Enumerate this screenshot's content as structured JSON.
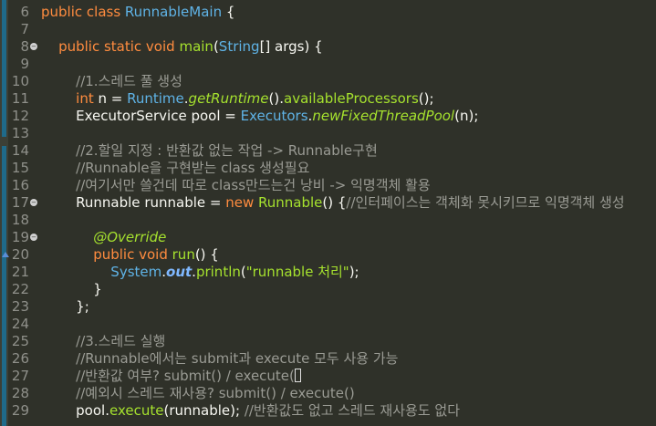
{
  "editor": {
    "language": "java",
    "colors": {
      "background": "#2f3129",
      "keyword": "#ff8c3f",
      "type": "#5fb3e6",
      "method": "#a6e22e",
      "comment": "#9a9b94",
      "line_number": "#8f908a",
      "gutter_strip": "#1f6a8a"
    },
    "lines": [
      {
        "n": "6",
        "fold": false,
        "segments": [
          [
            "kw",
            "public class "
          ],
          [
            "ty",
            "RunnableMain"
          ],
          [
            "op",
            " {"
          ]
        ]
      },
      {
        "n": "7",
        "fold": false,
        "segments": []
      },
      {
        "n": "8",
        "fold": true,
        "segments": [
          [
            "op",
            "    "
          ],
          [
            "kw",
            "public static void "
          ],
          [
            "fn",
            "main"
          ],
          [
            "op",
            "("
          ],
          [
            "ty",
            "String"
          ],
          [
            "op",
            "[] "
          ],
          [
            "id",
            "args"
          ],
          [
            "op",
            ") {"
          ]
        ]
      },
      {
        "n": "9",
        "fold": false,
        "segments": []
      },
      {
        "n": "10",
        "fold": false,
        "segments": [
          [
            "op",
            "        "
          ],
          [
            "cm",
            "//1.스레드 풀 생성"
          ]
        ]
      },
      {
        "n": "11",
        "fold": false,
        "segments": [
          [
            "op",
            "        "
          ],
          [
            "kw",
            "int "
          ],
          [
            "id",
            "n "
          ],
          [
            "op",
            "= "
          ],
          [
            "ty",
            "Runtime"
          ],
          [
            "op",
            "."
          ],
          [
            "it",
            "getRuntime"
          ],
          [
            "op",
            "()."
          ],
          [
            "fn",
            "availableProcessors"
          ],
          [
            "op",
            "();"
          ]
        ]
      },
      {
        "n": "12",
        "fold": false,
        "segments": [
          [
            "op",
            "        "
          ],
          [
            "id",
            "ExecutorService "
          ],
          [
            "id",
            "pool "
          ],
          [
            "op",
            "= "
          ],
          [
            "ty",
            "Executors"
          ],
          [
            "op",
            "."
          ],
          [
            "it",
            "newFixedThreadPool"
          ],
          [
            "op",
            "("
          ],
          [
            "id",
            "n"
          ],
          [
            "op",
            ");"
          ]
        ]
      },
      {
        "n": "13",
        "fold": false,
        "segments": []
      },
      {
        "n": "14",
        "fold": false,
        "segments": [
          [
            "op",
            "        "
          ],
          [
            "cm",
            "//2.할일 지정 : 반환값 없는 작업 -> Runnable구현"
          ]
        ]
      },
      {
        "n": "15",
        "fold": false,
        "segments": [
          [
            "op",
            "        "
          ],
          [
            "cm",
            "//Runnable을 구현받는 class 생성필요"
          ]
        ]
      },
      {
        "n": "16",
        "fold": false,
        "segments": [
          [
            "op",
            "        "
          ],
          [
            "cm",
            "//여기서만 쓸건데 따로 class만드는건 낭비 -> 익명객체 활용"
          ]
        ]
      },
      {
        "n": "17",
        "fold": true,
        "segments": [
          [
            "op",
            "        "
          ],
          [
            "id",
            "Runnable "
          ],
          [
            "id",
            "runnable "
          ],
          [
            "op",
            "= "
          ],
          [
            "kw",
            "new "
          ],
          [
            "fn",
            "Runnable"
          ],
          [
            "op",
            "() {"
          ],
          [
            "cm",
            "//인터페이스는 객체화 못시키므로 익명객체 생성"
          ]
        ]
      },
      {
        "n": "18",
        "fold": false,
        "segments": []
      },
      {
        "n": "19",
        "fold": true,
        "segments": [
          [
            "op",
            "            "
          ],
          [
            "ann",
            "@Override"
          ]
        ]
      },
      {
        "n": "20",
        "fold": false,
        "override": true,
        "segments": [
          [
            "op",
            "            "
          ],
          [
            "kw",
            "public void "
          ],
          [
            "fn",
            "run"
          ],
          [
            "op",
            "() {"
          ]
        ]
      },
      {
        "n": "21",
        "fold": false,
        "segments": [
          [
            "op",
            "                "
          ],
          [
            "ty",
            "System"
          ],
          [
            "op",
            "."
          ],
          [
            "fld",
            "out"
          ],
          [
            "op",
            "."
          ],
          [
            "fn",
            "println"
          ],
          [
            "op",
            "("
          ],
          [
            "st",
            "\"runnable 처리\""
          ],
          [
            "op",
            ");"
          ]
        ]
      },
      {
        "n": "22",
        "fold": false,
        "segments": [
          [
            "op",
            "            }"
          ]
        ]
      },
      {
        "n": "23",
        "fold": false,
        "segments": [
          [
            "op",
            "        };"
          ]
        ]
      },
      {
        "n": "24",
        "fold": false,
        "segments": []
      },
      {
        "n": "25",
        "fold": false,
        "segments": [
          [
            "op",
            "        "
          ],
          [
            "cm",
            "//3.스레드 실행"
          ]
        ]
      },
      {
        "n": "26",
        "fold": false,
        "segments": [
          [
            "op",
            "        "
          ],
          [
            "cm",
            "//Runnable에서는 submit과 execute 모두 사용 가능"
          ]
        ]
      },
      {
        "n": "27",
        "fold": false,
        "cursor": true,
        "segments": [
          [
            "op",
            "        "
          ],
          [
            "cm",
            "//반환값 여부? submit() / execute("
          ]
        ]
      },
      {
        "n": "28",
        "fold": false,
        "segments": [
          [
            "op",
            "        "
          ],
          [
            "cm",
            "//예외시 스레드 재사용? submit() / execute()"
          ]
        ]
      },
      {
        "n": "29",
        "fold": false,
        "segments": [
          [
            "op",
            "        "
          ],
          [
            "id",
            "pool"
          ],
          [
            "op",
            "."
          ],
          [
            "fn",
            "execute"
          ],
          [
            "op",
            "("
          ],
          [
            "id",
            "runnable"
          ],
          [
            "op",
            "); "
          ],
          [
            "cm",
            "//반환값도 없고 스레드 재사용도 없다"
          ]
        ]
      }
    ]
  }
}
